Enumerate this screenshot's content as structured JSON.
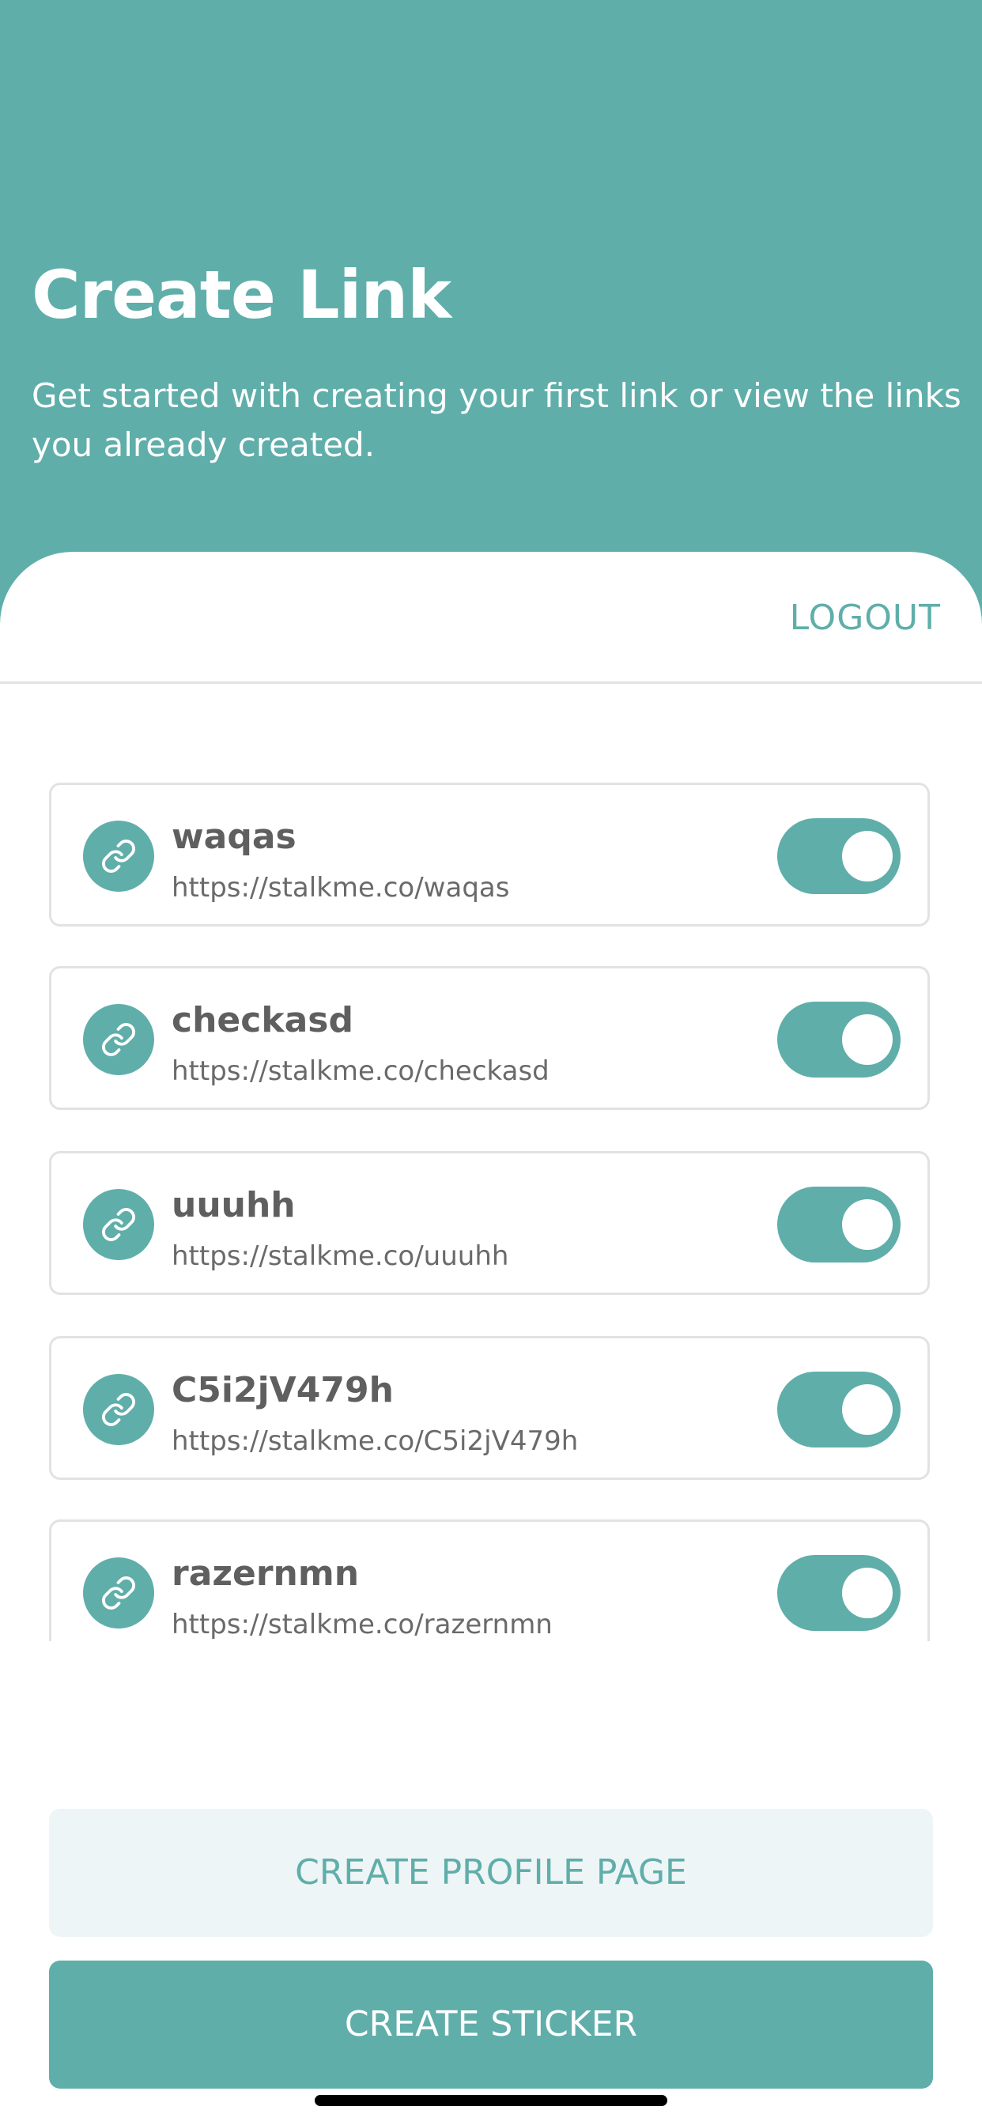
{
  "header": {
    "title": "Create Link",
    "subtitle": "Get started with creating your first link or view the links you already created."
  },
  "actions": {
    "logout_label": "LOGOUT"
  },
  "links": [
    {
      "name": "waqas",
      "url": "https://stalkme.co/waqas",
      "enabled": true
    },
    {
      "name": "checkasd",
      "url": "https://stalkme.co/checkasd",
      "enabled": true
    },
    {
      "name": "uuuhh",
      "url": "https://stalkme.co/uuuhh",
      "enabled": true
    },
    {
      "name": "C5i2jV479h",
      "url": "https://stalkme.co/C5i2jV479h",
      "enabled": true
    },
    {
      "name": "razernmn",
      "url": "https://stalkme.co/razernmn",
      "enabled": true
    }
  ],
  "buttons": {
    "create_profile_page": "CREATE PROFILE PAGE",
    "create_sticker": "CREATE STICKER"
  },
  "colors": {
    "accent": "#5faeaa",
    "secondary_button_bg": "#eef5f6",
    "text_dark": "#5f5f5f",
    "card_border": "#e2e2e2"
  },
  "icons": {
    "link": "link-icon"
  }
}
